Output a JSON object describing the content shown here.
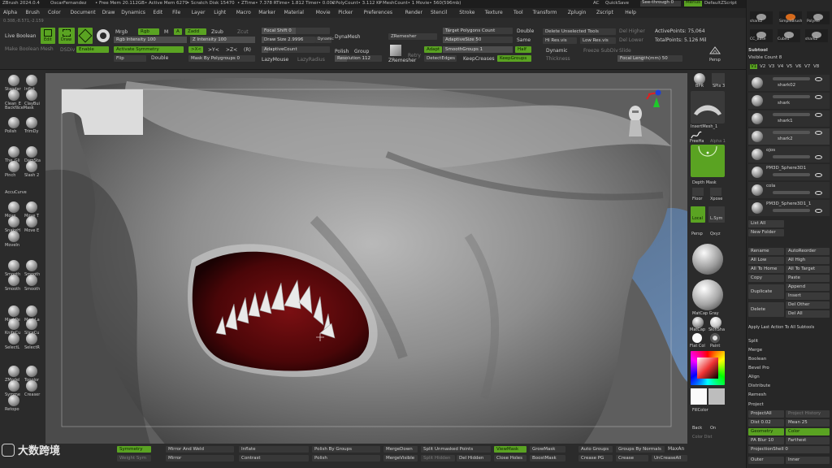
{
  "titlebar": {
    "app": "ZBrush 2024.0.4",
    "user": "OscarFernandez",
    "stats": [
      "• Free Mem 20.112GB",
      "• Active Mem 6279",
      "• Scratch Disk 15470",
      "• ZTime• 7.378 RTime• 1.812 Timer• 0.002",
      "• PolyCount• 3.112 KP",
      "• MeshCount• 1 Movie• 560(596mb)"
    ],
    "ac": "AC",
    "quicksave": "QuickSave",
    "seethrough": "See-through  0",
    "menus": "Menus",
    "script": "DefaultZScript"
  },
  "menubar": [
    "Alpha",
    "Brush",
    "Color",
    "Document",
    "Draw",
    "Dynamics",
    "Edit",
    "File",
    "Layer",
    "Light",
    "Macro",
    "Marker",
    "Material",
    "Movie",
    "Picker",
    "Preferences",
    "Render",
    "Stencil",
    "Stroke",
    "Texture",
    "Tool",
    "Transform",
    "Zplugin",
    "Zscript",
    "Help"
  ],
  "coords": "0.308,-8.571,-2.159",
  "shelf": {
    "live_boolean": "Live Boolean",
    "edit": "Edit",
    "draw": "Draw",
    "mrgb": "Mrgb",
    "rgb": "Rgb",
    "m": "M",
    "a": "A",
    "zadd": "Zadd",
    "zsub": "Zsub",
    "zcut": "Zcut",
    "rgb_intensity": "Rgb Intensity 100",
    "z_intensity": "Z Intensity 100",
    "focal_shift": "Focal Shift 0",
    "draw_size": "Draw Size 2.9996",
    "dynamic": "Dynamic",
    "dynamesh": "DynaMesh",
    "zremesher": "ZRemesher",
    "target_polys": "Target Polygons Count",
    "double": "Double",
    "delete_unselected": "Delete Unselected Tools",
    "del_higher": "Del Higher",
    "active_points": "ActivePoints: 75,064",
    "adaptive_size": "AdaptiveSize 50",
    "same": "Same",
    "hi_res": "Hi Res.vis",
    "low_res": "Low Res.vis",
    "del_lower": "Del Lower",
    "total_points": "TotalPoints: 5.126 Mil",
    "make_boolean_mesh": "Make Boolean Mesh",
    "dsdiv": "DSDiv",
    "enable": "Enable",
    "activate_symmetry": "Activate Symmetry",
    "x_axis": ">X<",
    "y_axis": ">Y<",
    "z_axis": ">Z<",
    "r": "(R)",
    "light": "Light",
    "adaptive_count": "AdaptiveCount",
    "polish": "Polish",
    "group": "Group",
    "adapt": "Adapt",
    "smoothgroups": "SmoothGroups 1",
    "half": "Half",
    "dynamic2": "Dynamic",
    "freeze_subdiv": "Freeze SubDiv",
    "slide": "Slide",
    "flip": "Flip",
    "double2": "Double",
    "mask_by_poly": "Mask By Polygroups 0",
    "lazymouse": "LazyMouse",
    "lazyradius": "LazyRadius",
    "resolution": "Resolution 112",
    "zremesher2": "ZRemesher",
    "retry": "Retry",
    "detect_edges": "DetectEdges",
    "keep_creases": "KeepCreases",
    "keep_groups": "KeepGroups",
    "thickness": "Thickness",
    "focal_length": "Focal Length(mm) 50",
    "persp": "Persp"
  },
  "tools": [
    {
      "a": "Standar",
      "b": "Inflat"
    },
    {
      "a": "Clean_E",
      "b": "ClayBui"
    },
    {
      "a": "BackfaceMask",
      "b": ""
    },
    {
      "a": "Polish",
      "b": "TrimDy"
    },
    {
      "a": "The_Gli",
      "b": "DamSta"
    },
    {
      "a": "Pinch",
      "b": "Slash 2"
    },
    {
      "a": "AccuCurve",
      "b": ""
    },
    {
      "a": "Move",
      "b": "Move T"
    },
    {
      "a": "SnakeH",
      "b": "Move E"
    },
    {
      "a": "MoveIn",
      "b": ""
    },
    {
      "a": "Smooth",
      "b": "Smooth"
    },
    {
      "a": "Smooth",
      "b": "Smooth"
    },
    {
      "a": "MaskPe",
      "b": "MaskLa"
    },
    {
      "a": "KnifeCu",
      "b": "SliceCu"
    },
    {
      "a": "SelectL",
      "b": "SelectR"
    },
    {
      "a": "ZModel",
      "b": "Topolor"
    },
    {
      "a": "Symme",
      "b": "Creaser"
    },
    {
      "a": "Retopo",
      "b": ""
    }
  ],
  "rightstrip": {
    "bpr": "BPR",
    "spix": "SPix 3",
    "insertmesh": "InsertMesh_1",
    "freehand": "FreeHa",
    "alpha": "Alpha 1",
    "depth_mask": "Depth Mask",
    "floor": "Floor",
    "xyz": "Xpose",
    "local": "Local",
    "lsym": "L.Sym",
    "persp": "Persp",
    "qxyz": "Qxyz",
    "matcap": "MatCap Gray",
    "matcap2": "MatCap",
    "skinshade": "SkinSha",
    "flat_color": "Flat Col",
    "paint": "Paint",
    "fillcolor": "FillColor",
    "back": "Back",
    "on": "On",
    "color_dist": "Color Dist"
  },
  "rightpanel": {
    "thumbs": [
      "shark2",
      "SimpleBrush",
      "PolyMe",
      "CC_Base",
      "Cube1",
      "shark2"
    ],
    "subtool_title": "Subtool",
    "visible_count": "Visible Count 8",
    "versions": [
      "V1",
      "V2",
      "V3",
      "V4",
      "V5",
      "V6",
      "V7",
      "V8"
    ],
    "subtools": [
      "shark02",
      "shark",
      "shark1",
      "shark2",
      "ojos",
      "PM3D_Sphere3D1",
      "cola",
      "PM3D_Sphere3D1_1"
    ],
    "list_all": "List All",
    "new_folder": "New Folder",
    "rename": "Rename",
    "auto_reorder": "AutoReorder",
    "all_low": "All Low",
    "all_high": "All High",
    "all_to_home": "All To Home",
    "all_to_target": "All To Target",
    "copy": "Copy",
    "paste": "Paste",
    "duplicate": "Duplicate",
    "append": "Append",
    "insert": "Insert",
    "delete": "Delete",
    "del_other": "Del Other",
    "del_all": "Del All",
    "apply_last": "Apply Last Action To All Subtools",
    "split": "Split",
    "merge": "Merge",
    "boolean": "Boolean",
    "bevel_pro": "Bevel Pro",
    "align": "Align",
    "distribute": "Distribute",
    "remesh": "Remesh",
    "project": "Project",
    "project_all": "ProjectAll",
    "project_history": "Project History",
    "dist": "Dist 0.02",
    "mean": "Mean 25",
    "geometry": "Geometry",
    "color": "Color",
    "pa_blur": "PA Blur 10",
    "farthest": "Farthest",
    "projection_shell": "ProjectionShell 0",
    "outer": "Outer",
    "inner": "Inner"
  },
  "bottom": {
    "symmetry": "Symmetry",
    "weight_sym": "Weight Sym",
    "mirror_and_weld": "Mirror And Weld",
    "mirror": "Mirror",
    "inflate": "Inflate",
    "contrast": "Contrast",
    "polish_groups": "Polish By Groups",
    "polish": "Polish",
    "mergedown": "MergeDown",
    "mergevisible": "MergeVisible",
    "split_unmasked": "Split Unmasked Points",
    "split_hidden": "Split Hidden",
    "del_hidden": "Del Hidden",
    "close_holes": "Close Holes",
    "viewmask": "ViewMask",
    "growmask": "GrowMask",
    "boostmask": "BoostMask",
    "auto_groups": "Auto Groups",
    "groups_normals": "Groups By Normals",
    "maxangle": "MaxAn",
    "crease_pg": "Crease PG",
    "crease": "Crease",
    "uncreaseall": "UnCreaseAll",
    "watermark": "大数跨境"
  }
}
